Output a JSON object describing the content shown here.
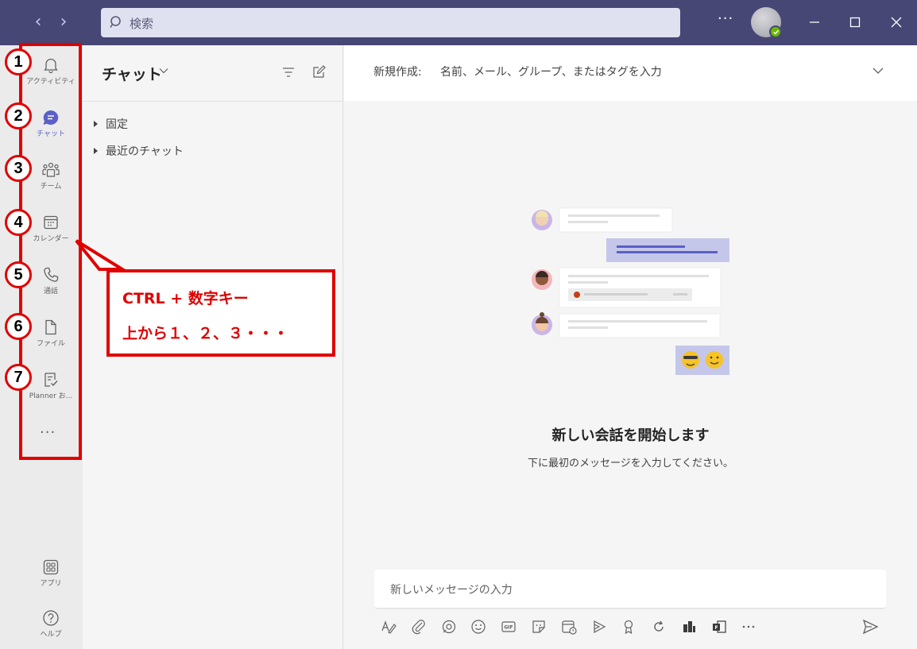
{
  "titlebar": {
    "search_placeholder": "検索",
    "more": "···"
  },
  "rail": {
    "items": [
      {
        "label": "アクティビティ",
        "icon": "bell-icon",
        "badge": "1"
      },
      {
        "label": "チャット",
        "icon": "chat-icon",
        "badge": "2",
        "active": true
      },
      {
        "label": "チーム",
        "icon": "teams-icon",
        "badge": "3"
      },
      {
        "label": "カレンダー",
        "icon": "calendar-icon",
        "badge": "4"
      },
      {
        "label": "通話",
        "icon": "phone-icon",
        "badge": "5"
      },
      {
        "label": "ファイル",
        "icon": "file-icon",
        "badge": "6"
      },
      {
        "label": "Planner お...",
        "icon": "planner-icon",
        "badge": "7"
      }
    ],
    "more": "···",
    "apps_label": "アプリ",
    "help_label": "ヘルプ"
  },
  "chatpane": {
    "title": "チャット",
    "sections": [
      "固定",
      "最近のチャット"
    ]
  },
  "main": {
    "to_label": "新規作成:",
    "to_placeholder": "名前、メール、グループ、またはタグを入力",
    "empty_title": "新しい会話を開始します",
    "empty_sub": "下に最初のメッセージを入力してください。",
    "compose_placeholder": "新しいメッセージの入力"
  },
  "callout": {
    "line1": "CTRL + 数字キー",
    "line2": "上から１、２、３・・・"
  },
  "colors": {
    "titlebar": "#464775",
    "accent": "#5b5fc7",
    "annotation_red": "#e00000"
  }
}
